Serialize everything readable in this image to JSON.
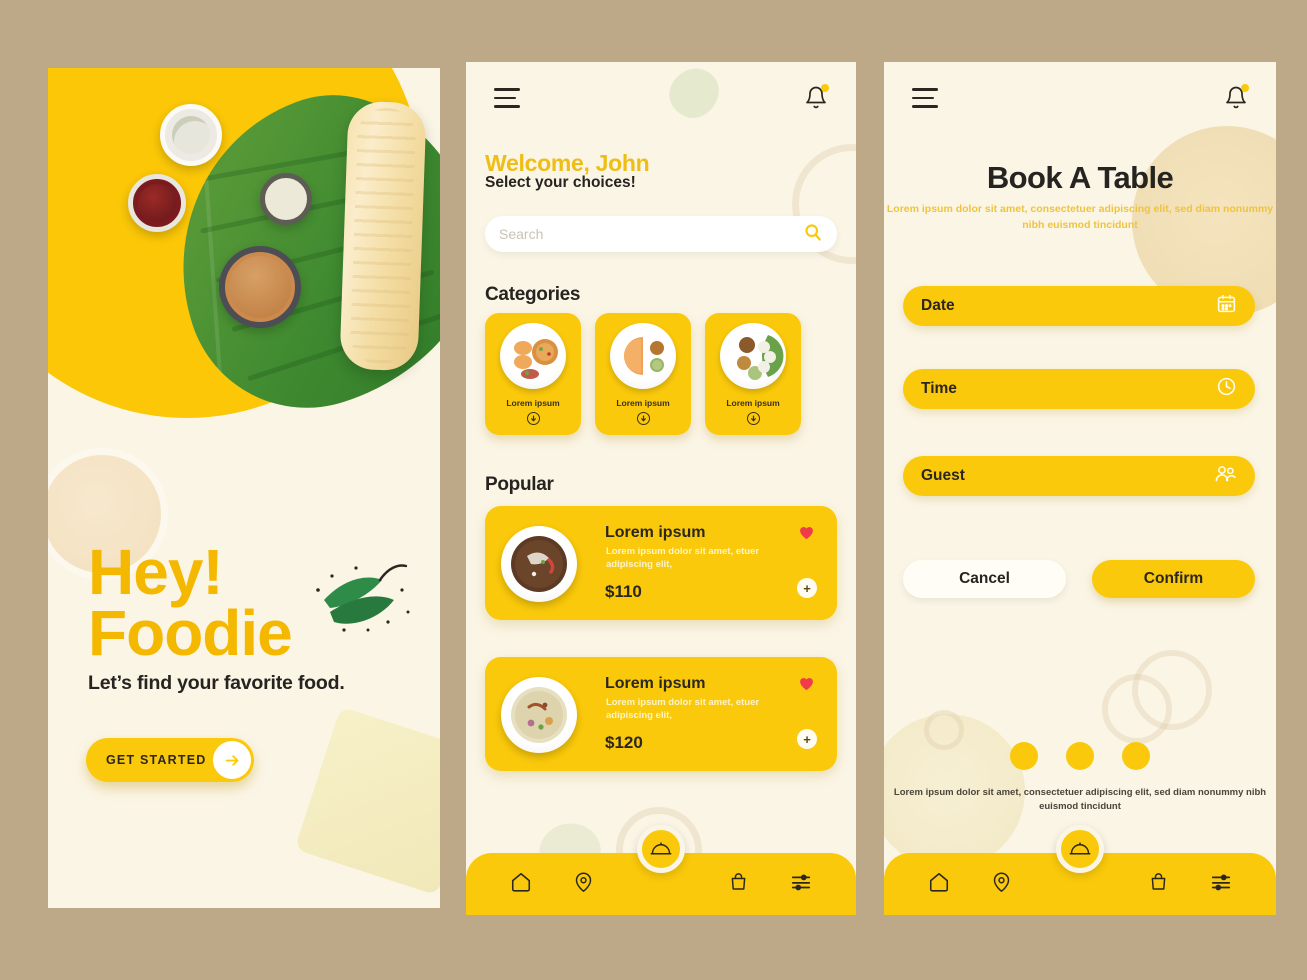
{
  "theme": {
    "background": "#bda887",
    "screen_bg": "#fbf5e6",
    "accent_yellow": "#fac90b",
    "title_yellow": "#f5b800",
    "dark_text": "#262420",
    "heart_red": "#ef3b4b"
  },
  "screen1": {
    "name": "onboarding",
    "title_line1": "Hey!",
    "title_line2": "Foodie",
    "subtitle": "Let’s find your favorite food.",
    "cta_label": "GET STARTED",
    "cta_icon": "arrow-right-icon"
  },
  "screen2": {
    "name": "home",
    "menu_icon": "hamburger-menu-icon",
    "bell_icon": "notification-bell-icon",
    "welcome": "Welcome, John",
    "sub_welcome": "Select your choices!",
    "search": {
      "placeholder": "Search",
      "value": "",
      "icon": "search-icon"
    },
    "categories_title": "Categories",
    "categories": [
      {
        "label": "Lorem ipsum",
        "icon": "arrow-down-circle-icon"
      },
      {
        "label": "Lorem ipsum",
        "icon": "arrow-down-circle-icon"
      },
      {
        "label": "Lorem ipsum",
        "icon": "arrow-down-circle-icon"
      }
    ],
    "popular_title": "Popular",
    "popular": [
      {
        "name": "Lorem ipsum",
        "desc": "Lorem ipsum dolor sit amet, etuer adipiscing elit,",
        "price": "$110",
        "heart_icon": "heart-icon",
        "add_icon": "plus-icon"
      },
      {
        "name": "Lorem ipsum",
        "desc": "Lorem ipsum dolor sit amet, etuer adipiscing elit,",
        "price": "$120",
        "heart_icon": "heart-icon",
        "add_icon": "plus-icon"
      }
    ],
    "bottom_nav": {
      "fab_icon": "food-cloche-icon",
      "items": [
        {
          "icon": "home-icon"
        },
        {
          "icon": "location-pin-icon"
        },
        {
          "icon": "shopping-bag-icon"
        },
        {
          "icon": "filter-sliders-icon"
        }
      ]
    }
  },
  "screen3": {
    "name": "book-a-table",
    "menu_icon": "hamburger-menu-icon",
    "bell_icon": "notification-bell-icon",
    "title": "Book A Table",
    "subtitle": "Lorem ipsum dolor sit amet, consectetuer adipiscing elit, sed diam nonummy nibh euismod tincidunt",
    "fields": [
      {
        "label": "Date",
        "icon": "calendar-icon"
      },
      {
        "label": "Time",
        "icon": "clock-icon"
      },
      {
        "label": "Guest",
        "icon": "people-icon"
      }
    ],
    "cancel_label": "Cancel",
    "confirm_label": "Confirm",
    "footer_text": "Lorem ipsum dolor sit amet, consectetuer adipiscing elit, sed diam nonummy nibh euismod tincidunt",
    "bottom_nav": {
      "fab_icon": "food-cloche-icon",
      "items": [
        {
          "icon": "home-icon"
        },
        {
          "icon": "location-pin-icon"
        },
        {
          "icon": "shopping-bag-icon"
        },
        {
          "icon": "filter-sliders-icon"
        }
      ]
    }
  }
}
